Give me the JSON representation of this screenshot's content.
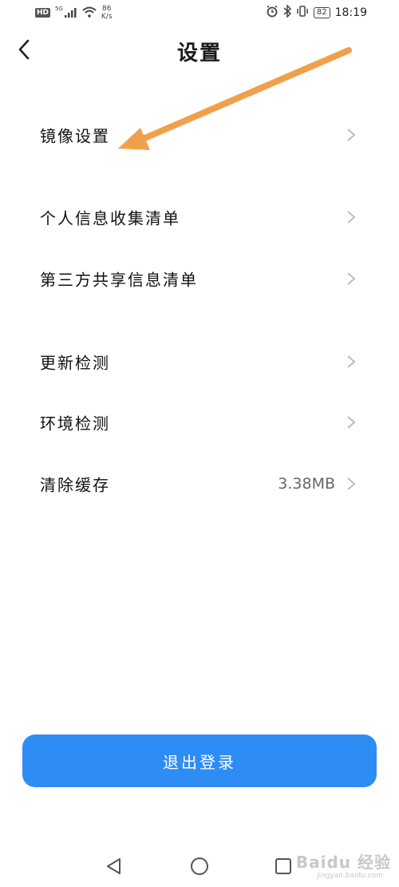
{
  "status_bar": {
    "hd": "HD",
    "network": "5G",
    "speed_value": "86",
    "speed_unit": "K/s",
    "battery": "82",
    "time": "18:19"
  },
  "header": {
    "title": "设置"
  },
  "settings": {
    "mirror": {
      "label": "镜像设置"
    },
    "personal_info": {
      "label": "个人信息收集清单"
    },
    "third_party": {
      "label": "第三方共享信息清单"
    },
    "update_check": {
      "label": "更新检测"
    },
    "env_check": {
      "label": "环境检测"
    },
    "clear_cache": {
      "label": "清除缓存",
      "value": "3.38MB"
    }
  },
  "logout": {
    "label": "退出登录"
  },
  "annotation": {
    "color": "#f0a04b"
  },
  "colors": {
    "accent": "#2e8cf5",
    "chevron": "#b5b5b5"
  },
  "watermark": {
    "text": "Baidu 经验",
    "sub": "jingyan.baidu.com"
  }
}
